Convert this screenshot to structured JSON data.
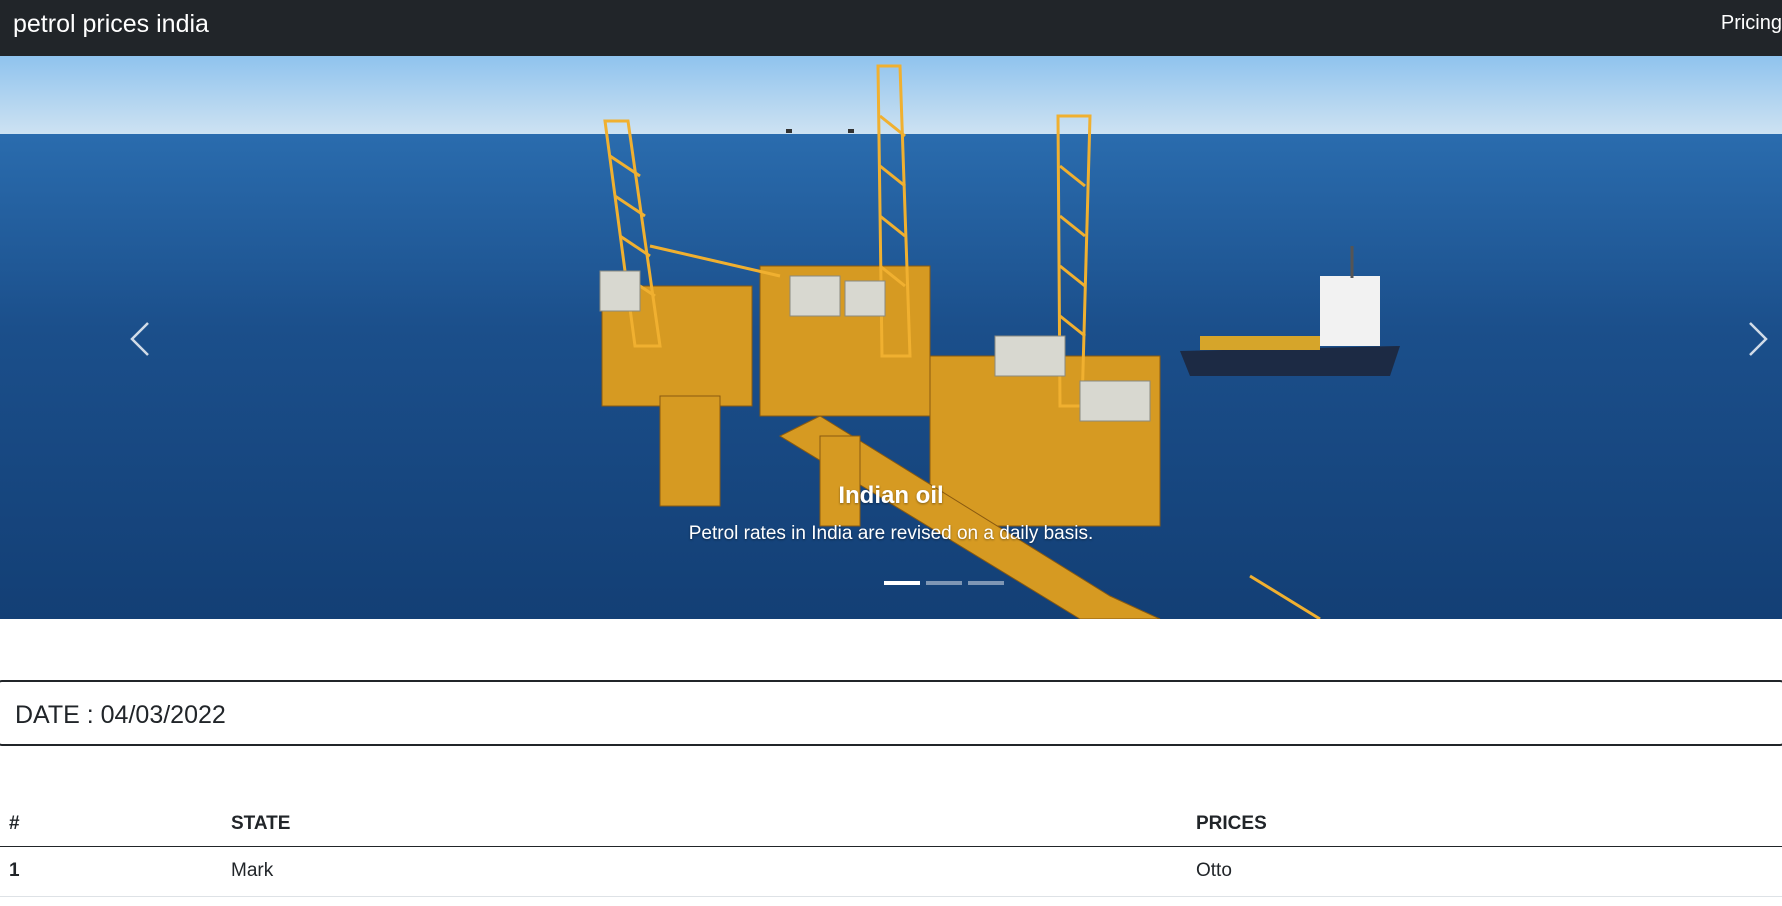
{
  "navbar": {
    "brand": "petrol prices india",
    "links": [
      "Pricing"
    ]
  },
  "carousel": {
    "slide": {
      "title": "Indian oil",
      "text": "Petrol rates in India are revised on a daily basis."
    },
    "indicators": 3,
    "active_index": 0,
    "prev_icon": "chevron-left-icon",
    "next_icon": "chevron-right-icon"
  },
  "date_card": {
    "text": "DATE : 04/03/2022"
  },
  "table": {
    "headers": [
      "#",
      "STATE",
      "PRICES"
    ],
    "rows": [
      [
        "1",
        "Mark",
        "Otto"
      ]
    ]
  },
  "colors": {
    "navbar_bg": "#212529",
    "sea": "#1a4f8a",
    "sky": "#9cc8ec",
    "rig": "#e0a52a"
  }
}
